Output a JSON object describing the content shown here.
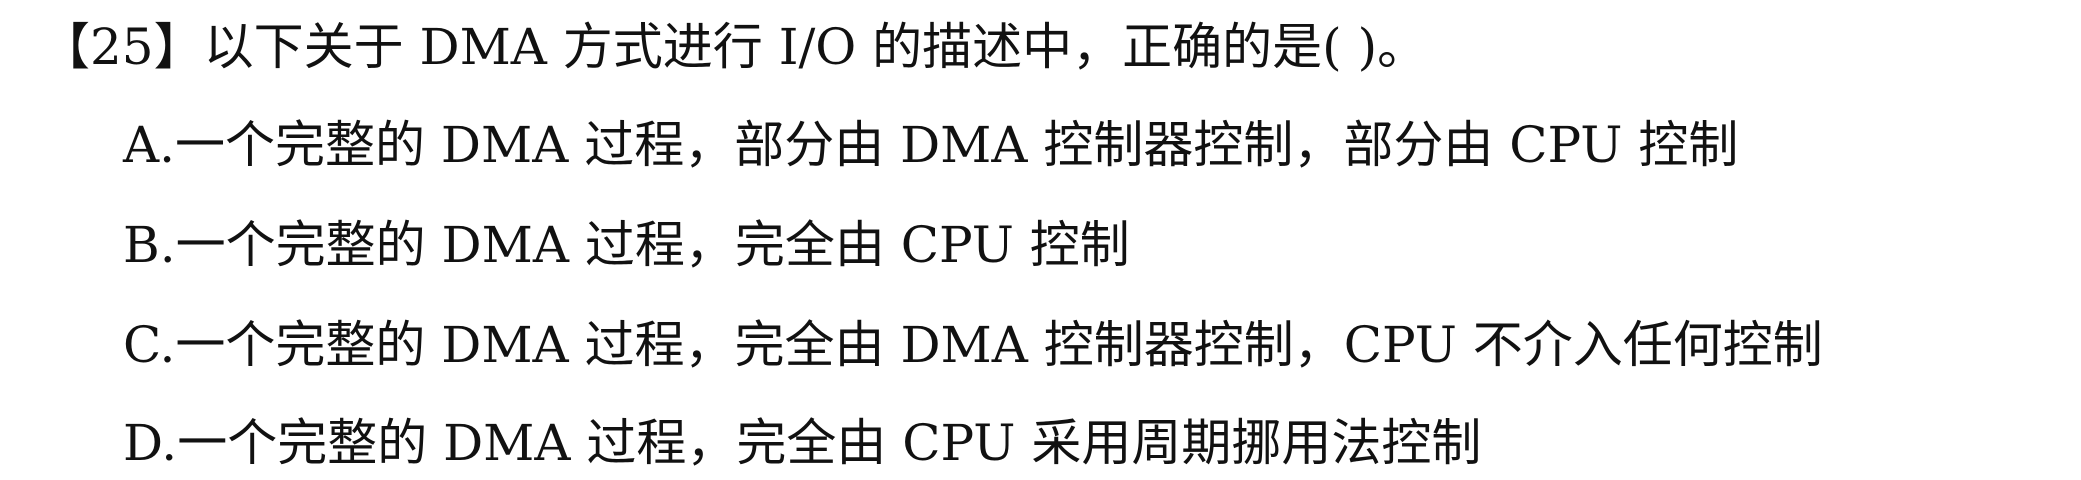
{
  "question": {
    "number_bracketed": "【25】",
    "stem": "以下关于 DMA 方式进行 I/O 的描述中，正确的是(      )。"
  },
  "options": [
    {
      "label": "A.",
      "text": "一个完整的 DMA 过程，部分由 DMA 控制器控制，部分由 CPU 控制"
    },
    {
      "label": "B.",
      "text": "一个完整的 DMA 过程，完全由 CPU 控制"
    },
    {
      "label": "C.",
      "text": "一个完整的 DMA 过程，完全由 DMA 控制器控制，CPU 不介入任何控制"
    },
    {
      "label": "D.",
      "text": "一个完整的 DMA 过程，完全由 CPU 采用周期挪用法控制"
    }
  ]
}
